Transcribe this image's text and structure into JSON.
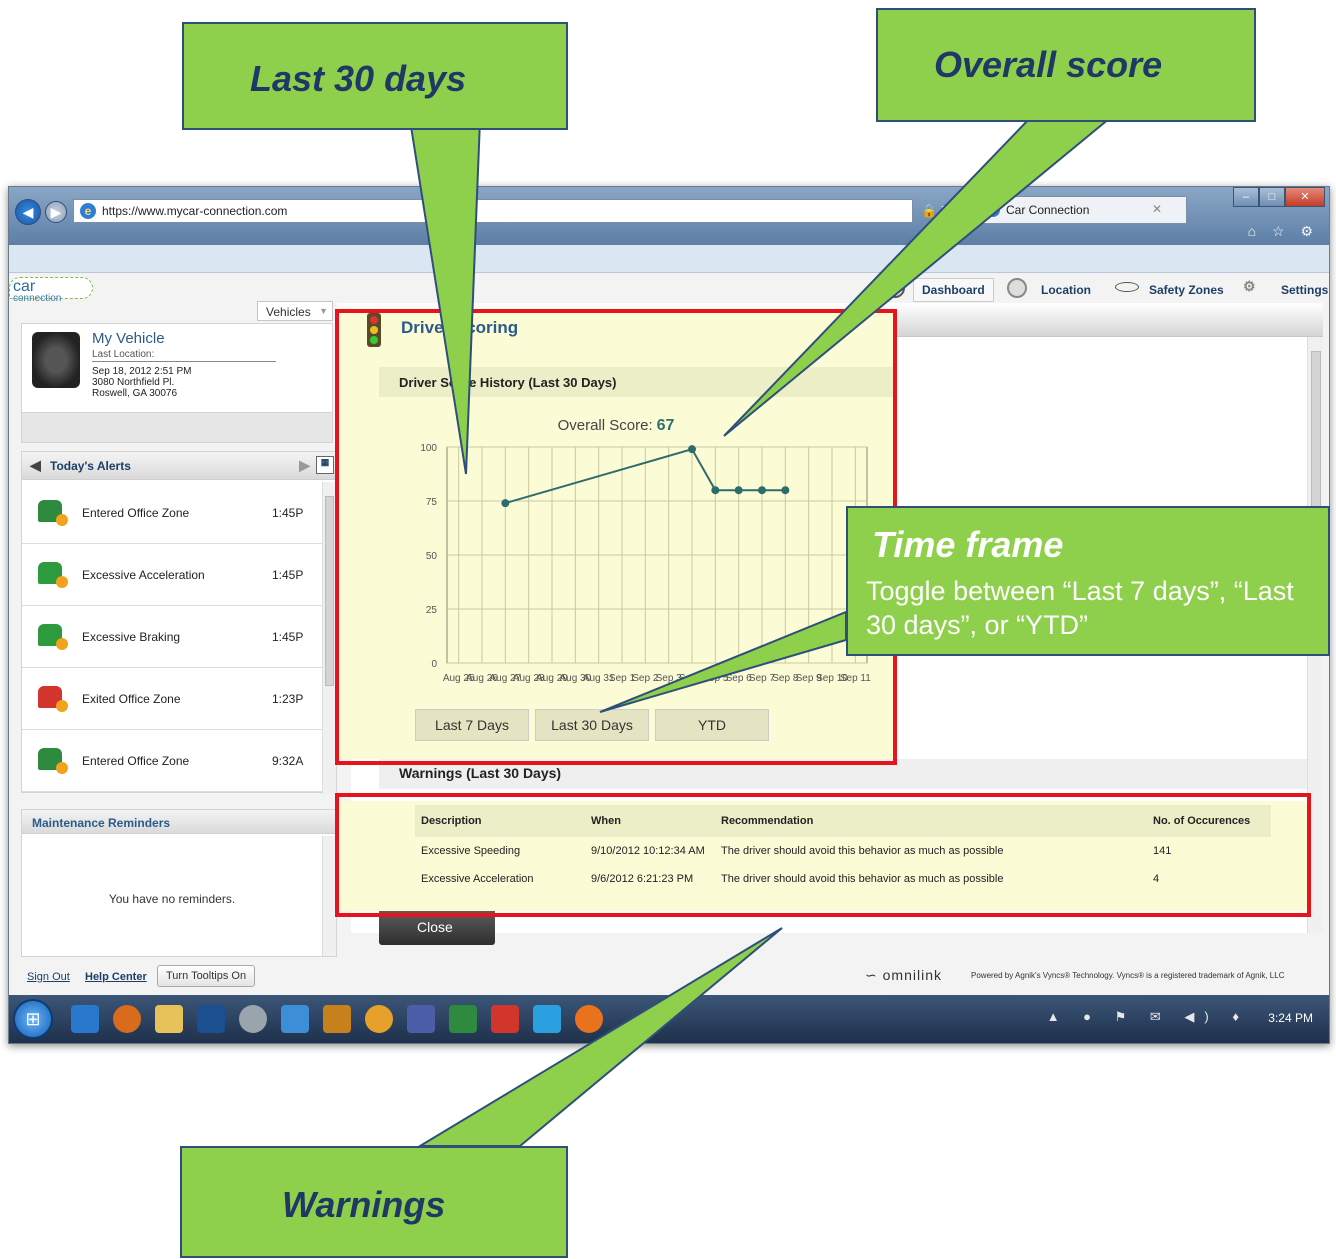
{
  "browser": {
    "url": "https://www.mycar-connection.com",
    "tab_title": "Car Connection",
    "addr_controls": "🔒 ↻ ✕",
    "tab_close": "✕",
    "icons_text": "⌂ ☆ ⚙"
  },
  "app": {
    "logo_text": "car",
    "logo_sub": "connection",
    "nav": {
      "dashboard": "Dashboard",
      "location": "Location",
      "safety_zones": "Safety Zones",
      "settings": "Settings"
    }
  },
  "sidebar": {
    "vehicles_tab": "Vehicles",
    "vehicle": {
      "name": "My Vehicle",
      "last_location_label": "Last Location:",
      "date": "Sep 18, 2012 2:51 PM",
      "address1": "3080 Northfield Pl.",
      "address2": "Roswell, GA 30076"
    },
    "alerts_title": "Today's Alerts",
    "alerts": [
      {
        "label": "Entered Office Zone",
        "time": "1:45P",
        "icon": "zone-enter-icon"
      },
      {
        "label": "Excessive Acceleration",
        "time": "1:45P",
        "icon": "car-acceleration-icon"
      },
      {
        "label": "Excessive Braking",
        "time": "1:45P",
        "icon": "car-braking-icon"
      },
      {
        "label": "Exited Office Zone",
        "time": "1:23P",
        "icon": "zone-exit-icon"
      },
      {
        "label": "Entered Office Zone",
        "time": "9:32A",
        "icon": "zone-enter-icon"
      }
    ],
    "maintenance_title": "Maintenance Reminders",
    "maintenance_empty": "You have no reminders."
  },
  "footer": {
    "sign_out": "Sign Out",
    "help_center": "Help Center",
    "tooltips_button": "Turn Tooltips On",
    "omnilink": "omnilink",
    "powered_by": "Powered by Agnik's Vyncs® Technology. Vyncs® is a registered trademark of Agnik, LLC"
  },
  "driver_scoring": {
    "title": "Driver Scoring",
    "history_title": "Driver Score History (Last 30 Days)",
    "overall_label": "Overall Score:",
    "overall_value": "67",
    "range_buttons": [
      "Last 7 Days",
      "Last 30 Days",
      "YTD"
    ]
  },
  "chart_data": {
    "type": "line",
    "categories": [
      "Aug 25",
      "Aug 26",
      "Aug 27",
      "Aug 28",
      "Aug 29",
      "Aug 30",
      "Aug 31",
      "Sep 1",
      "Sep 2",
      "Sep 3",
      "Sep 4",
      "Sep 5",
      "Sep 6",
      "Sep 7",
      "Sep 8",
      "Sep 9",
      "Sep 10",
      "Sep 11"
    ],
    "x_tick_labels": [
      "Aug 25",
      "Aug 26",
      "Aug 27",
      "Aug 28",
      "Aug 29",
      "Aug 30",
      "Aug 31",
      "Sep 1",
      "Sep 2",
      "Sep 3",
      "Sep 4",
      "Sep 5",
      "Sep 6",
      "Sep 7",
      "Sep 8",
      "Sep 9",
      "Sep 10",
      "Sep 11"
    ],
    "series": [
      {
        "points": [
          {
            "x": "Aug 27",
            "y": 74
          },
          {
            "x": "Sep 4",
            "y": 99
          },
          {
            "x": "Sep 5",
            "y": 80
          },
          {
            "x": "Sep 6",
            "y": 80
          },
          {
            "x": "Sep 7",
            "y": 80
          },
          {
            "x": "Sep 8",
            "y": 80
          }
        ]
      }
    ],
    "yticks": [
      0,
      25,
      50,
      75,
      100
    ],
    "ylim": [
      0,
      100
    ],
    "grid": true,
    "line_color": "#2e6b6b"
  },
  "warnings": {
    "title": "Warnings (Last 30 Days)",
    "columns": [
      "Description",
      "When",
      "Recommendation",
      "No. of Occurences"
    ],
    "rows": [
      [
        "Excessive Speeding",
        "9/10/2012 10:12:34 AM",
        "The driver should avoid this behavior as much as possible",
        "141"
      ],
      [
        "Excessive Acceleration",
        "9/6/2012 6:21:23 PM",
        "The driver should avoid this behavior as much as possible",
        "4"
      ]
    ],
    "close_button": "Close"
  },
  "taskbar": {
    "time": "3:24 PM",
    "tray_icons": "▲ ● ⚑ ✉ ◀) ♦"
  },
  "callouts": {
    "last30": {
      "title": "Last 30 days"
    },
    "overall": {
      "title": "Overall score"
    },
    "timeframe": {
      "title": "Time frame",
      "body": "Toggle between “Last 7 days”, “Last 30 days”, or “YTD”"
    },
    "warnings": {
      "title": "Warnings"
    }
  },
  "colors": {
    "callout_fill": "#8ed04c",
    "callout_text": "#1f3865",
    "highlight_red": "#e8141c",
    "panel_yellow": "#fbfbd6"
  }
}
